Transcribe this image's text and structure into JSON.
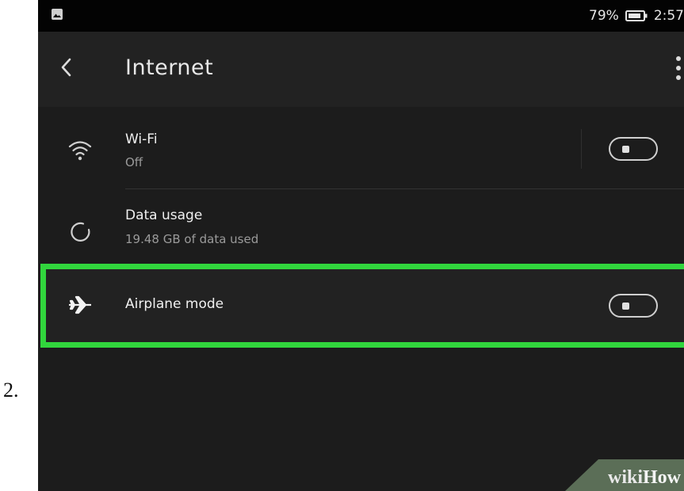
{
  "step": {
    "number": "2."
  },
  "statusbar": {
    "battery": "79%",
    "time": "2:57"
  },
  "appbar": {
    "title": "Internet"
  },
  "settings": [
    {
      "icon": "wifi-icon",
      "title": "Wi-Fi",
      "subtitle": "Off",
      "toggle_on": false
    },
    {
      "icon": "data-usage-icon",
      "title": "Data usage",
      "subtitle": "19.48 GB of data used"
    },
    {
      "icon": "airplane-icon",
      "title": "Airplane mode",
      "toggle_on": false,
      "highlighted": true
    }
  ],
  "colors": {
    "highlight": "#31d63d",
    "background": "#1c1c1c",
    "appbar": "#222222"
  },
  "watermark": {
    "part1": "wiki",
    "part2": "How"
  }
}
